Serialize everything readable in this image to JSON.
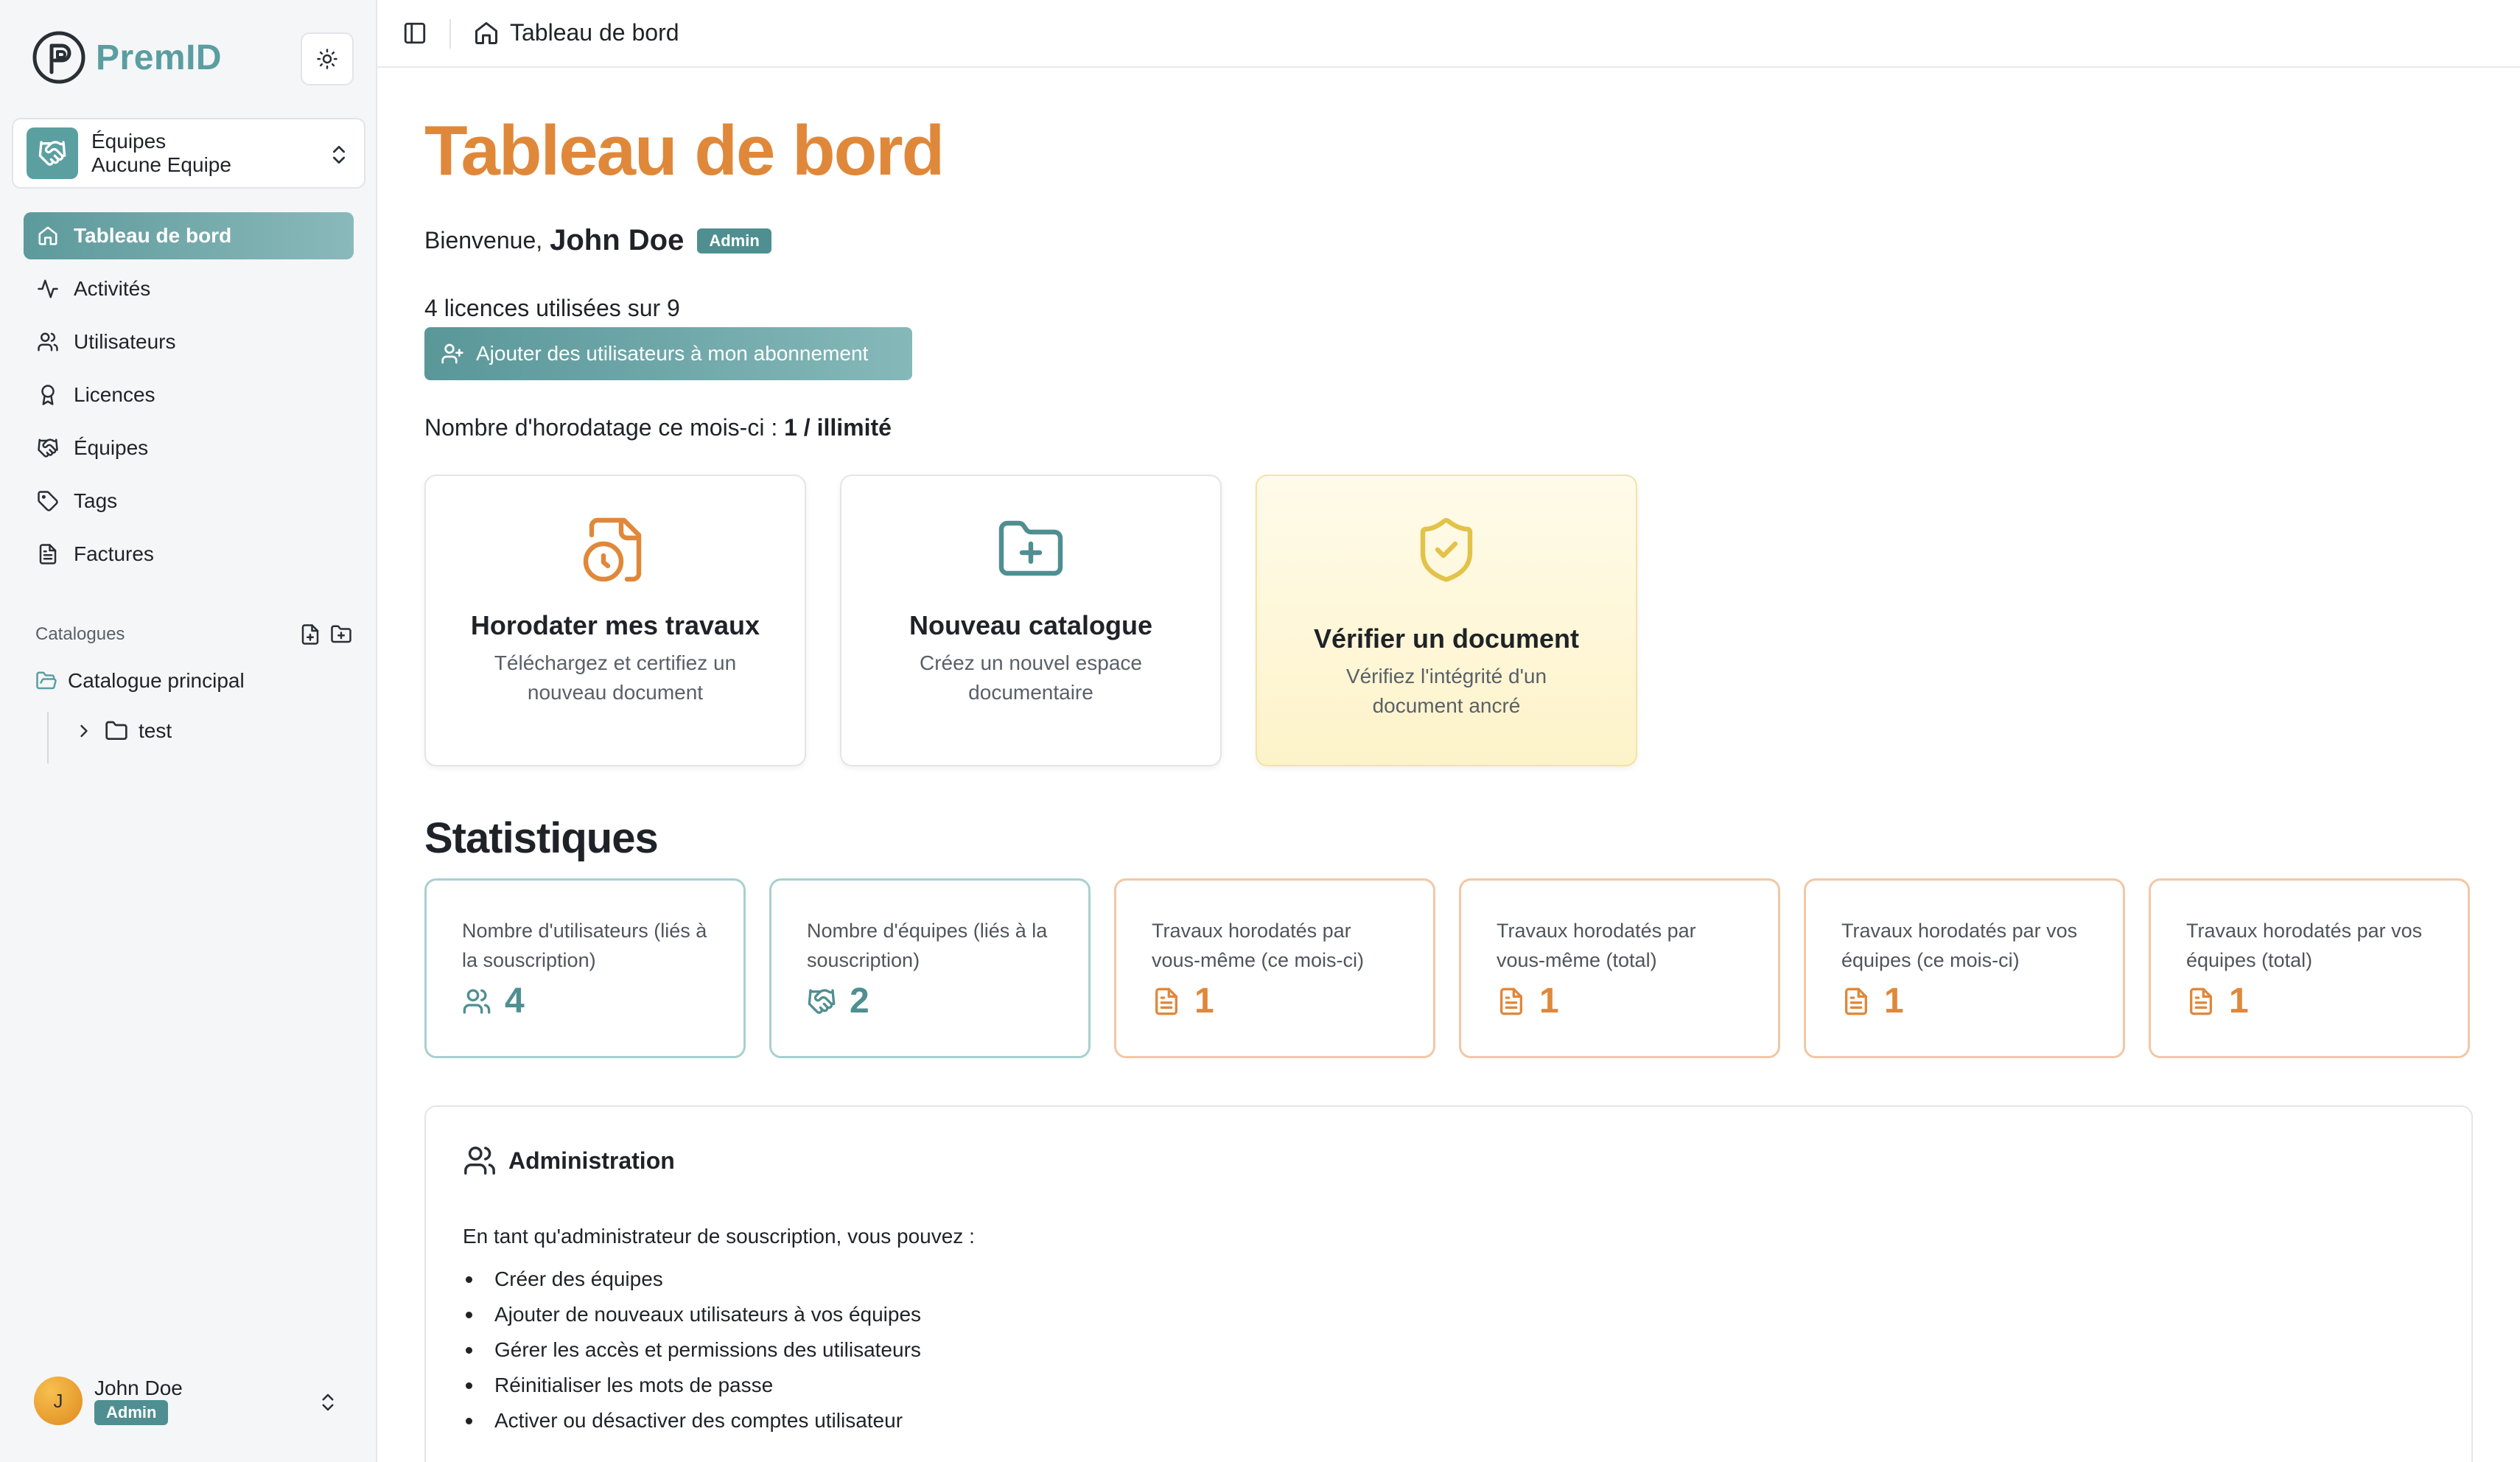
{
  "app": {
    "name": "PremID"
  },
  "team_switcher": {
    "title": "Équipes",
    "subtitle": "Aucune Equipe"
  },
  "sidebar": {
    "items": [
      {
        "label": "Tableau de bord",
        "icon": "home-icon",
        "active": true
      },
      {
        "label": "Activités",
        "icon": "activity-icon"
      },
      {
        "label": "Utilisateurs",
        "icon": "users-icon"
      },
      {
        "label": "Licences",
        "icon": "award-icon"
      },
      {
        "label": "Équipes",
        "icon": "handshake-icon"
      },
      {
        "label": "Tags",
        "icon": "tag-icon"
      },
      {
        "label": "Factures",
        "icon": "file-text-icon"
      }
    ],
    "catalogues_label": "Catalogues",
    "catalogues": [
      {
        "label": "Catalogue principal",
        "icon": "folder-open-icon"
      },
      {
        "label": "test",
        "icon": "folder-icon",
        "child": true
      }
    ]
  },
  "user": {
    "name": "John Doe",
    "initial": "J",
    "role": "Admin"
  },
  "breadcrumb": {
    "label": "Tableau de bord"
  },
  "main": {
    "title": "Tableau de bord",
    "welcome_prefix": "Bienvenue,",
    "welcome_name": "John Doe",
    "welcome_badge": "Admin",
    "licences_text": "4 licences utilisées sur 9",
    "add_users_label": "Ajouter des utilisateurs à mon abonnement",
    "timestamps_prefix": "Nombre d'horodatage ce mois-ci :",
    "timestamps_value": "1 / illimité"
  },
  "actions": [
    {
      "title": "Horodater mes travaux",
      "desc": "Téléchargez et certifiez un nouveau document",
      "icon": "file-clock-icon",
      "color": "#e0883a"
    },
    {
      "title": "Nouveau catalogue",
      "desc": "Créez un nouvel espace documentaire",
      "icon": "folder-plus-icon",
      "color": "#4f8f91"
    },
    {
      "title": "Vérifier un document",
      "desc": "Vérifiez l'intégrité d'un document ancré",
      "icon": "shield-check-icon",
      "color": "#e3c24a"
    }
  ],
  "stats": {
    "title": "Statistiques",
    "cards": [
      {
        "label": "Nombre d'utilisateurs (liés à la souscription)",
        "value": "4",
        "icon": "users-icon",
        "tone": "teal"
      },
      {
        "label": "Nombre d'équipes (liés à la souscription)",
        "value": "2",
        "icon": "handshake-icon",
        "tone": "teal"
      },
      {
        "label": "Travaux horodatés par vous-même (ce mois-ci)",
        "value": "1",
        "icon": "file-text-icon",
        "tone": "orange"
      },
      {
        "label": "Travaux horodatés par vous-même (total)",
        "value": "1",
        "icon": "file-text-icon",
        "tone": "orange"
      },
      {
        "label": "Travaux horodatés par vos équipes (ce mois-ci)",
        "value": "1",
        "icon": "file-text-icon",
        "tone": "orange"
      },
      {
        "label": "Travaux horodatés par vos équipes (total)",
        "value": "1",
        "icon": "file-text-icon",
        "tone": "orange"
      }
    ]
  },
  "admin": {
    "title": "Administration",
    "intro": "En tant qu'administrateur de souscription, vous pouvez :",
    "items": [
      "Créer des équipes",
      "Ajouter de nouveaux utilisateurs à vos équipes",
      "Gérer les accès et permissions des utilisateurs",
      "Réinitialiser les mots de passe",
      "Activer ou désactiver des comptes utilisateur"
    ]
  },
  "colors": {
    "accent": "#5a9ea1",
    "orange": "#e0883a",
    "yellow": "#e3c24a"
  }
}
